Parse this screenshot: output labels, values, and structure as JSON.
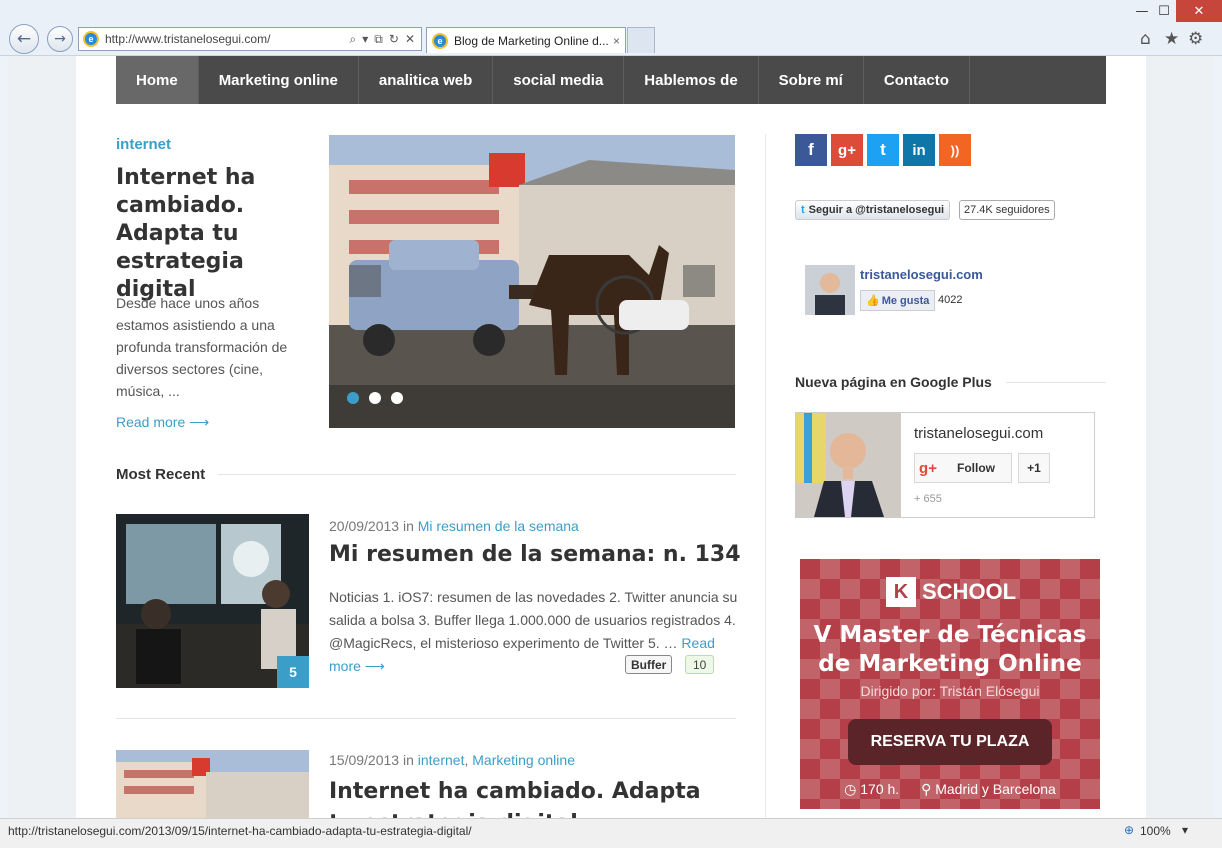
{
  "browser": {
    "url": "http://www.tristanelosegui.com/",
    "tab_title": "Blog de Marketing Online d...",
    "tab_close": "×",
    "back_icon": "←",
    "forward_icon": "→",
    "search_glyph": "⌕",
    "dropdown_glyph": "▾",
    "compat_glyph": "⧉",
    "refresh_glyph": "↻",
    "addr_close_glyph": "✕",
    "minimize": "—",
    "maximize": "☐",
    "close": "✕",
    "home_icon": "⌂",
    "star_icon": "★",
    "gear_icon": "⚙",
    "status_url": "http://tristanelosegui.com/2013/09/15/internet-ha-cambiado-adapta-tu-estrategia-digital/",
    "zoom": "100%",
    "zoom_dropdown": "▾",
    "zoom_glyph": "⊕"
  },
  "nav": {
    "items": [
      {
        "label": "Home",
        "active": true
      },
      {
        "label": "Marketing online"
      },
      {
        "label": "analitica web"
      },
      {
        "label": "social media"
      },
      {
        "label": "Hablemos de"
      },
      {
        "label": "Sobre mí"
      },
      {
        "label": "Contacto"
      }
    ]
  },
  "featured": {
    "category": "internet",
    "title": "Internet ha cambiado. Adapta tu estrategia digital",
    "excerpt": "Desde hace unos años estamos asistiendo a una profunda transformación de diversos sectores (cine, música, ...",
    "read_more": "Read more ⟶"
  },
  "most_recent": {
    "heading": "Most Recent",
    "posts": [
      {
        "date": "20/09/2013",
        "in_label": "in",
        "category": "Mi resumen de la semana",
        "title": "Mi resumen de la semana: n. 134",
        "excerpt": "Noticias 1. iOS7: resumen de las novedades 2. Twitter anuncia su salida a bolsa 3. Buffer llega 1.000.000 de usuarios registrados 4. @MagicRecs, el misterioso experimento de Twitter 5. …",
        "read_more": "Read more ⟶",
        "comments": "5",
        "buffer_label": "Buffer",
        "buffer_count": "10"
      },
      {
        "date": "15/09/2013",
        "in_label": "in",
        "category": "internet",
        "category_sep": ",",
        "category2": "Marketing online",
        "title": "Internet ha cambiado. Adapta tu estrategia digital"
      }
    ]
  },
  "sidebar": {
    "social": {
      "facebook": "f",
      "googleplus": "g+",
      "twitter": "t",
      "linkedin": "in",
      "rss": "))"
    },
    "twitter_follow": "Seguir a @tristanelosegui",
    "twitter_count": "27.4K seguidores",
    "twitter_glyph": "t",
    "fb_name": "tristanelosegui.com",
    "fb_like": "Me gusta",
    "fb_like_glyph": "👍",
    "fb_count": "4022",
    "gp_heading": "Nueva página en Google Plus",
    "gp_name": "tristanelosegui.com",
    "gp_follow": "Follow",
    "gp_glyph": "g+",
    "gp_plus": "+1",
    "gp_count": "+ 655"
  },
  "ad": {
    "brand_k": "K",
    "brand": "SCHOOL",
    "title_line1": "V Master de Técnicas",
    "title_line2": "de Marketing Online",
    "subtitle": "Dirigido por: Tristán Elósegui",
    "button": "RESERVA TU PLAZA",
    "clock_glyph": "◷",
    "hours": "170 h.",
    "pin_glyph": "⚲",
    "location": "Madrid y Barcelona"
  },
  "colors": {
    "accent": "#3a9ec9",
    "nav_bg": "#4a4a4a",
    "facebook": "#3b5998",
    "googleplus": "#dd4b39",
    "twitter": "#1da1f2",
    "linkedin": "#0e76a8",
    "rss": "#f26522",
    "ad_bg": "#b53f48"
  }
}
